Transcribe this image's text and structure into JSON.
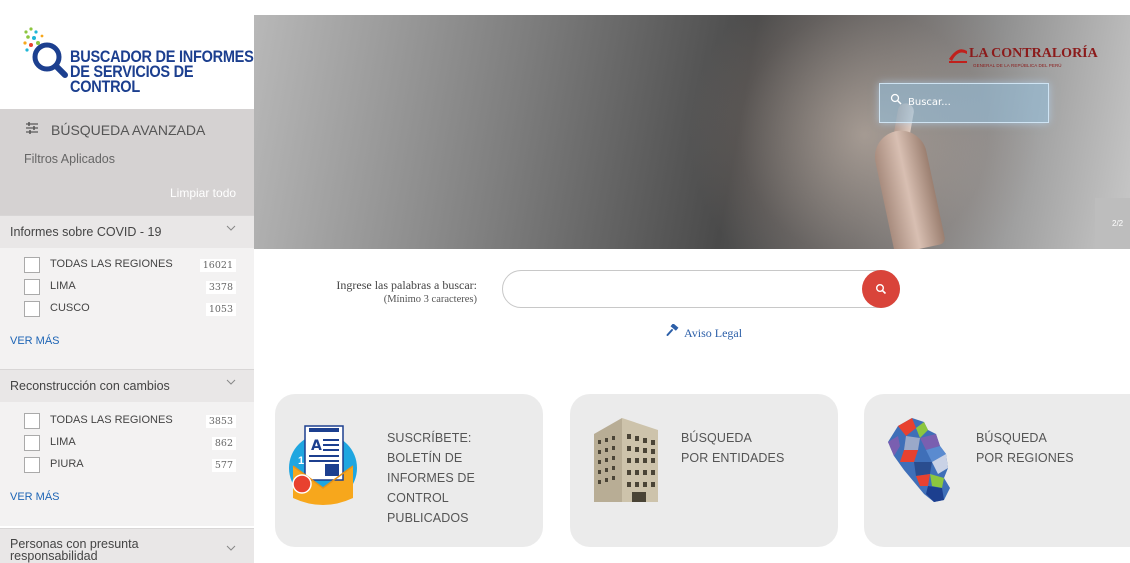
{
  "logo": {
    "line1": "BUSCADOR DE INFORMES",
    "line2": "DE SERVICIOS DE CONTROL"
  },
  "advanced": {
    "title": "BÚSQUEDA AVANZADA",
    "filters_label": "Filtros Aplicados",
    "clear_all": "Limpiar todo"
  },
  "sections": [
    {
      "title": "Informes sobre COVID - 19",
      "items": [
        {
          "label": "TODAS LAS REGIONES",
          "count": "16021"
        },
        {
          "label": "LIMA",
          "count": "3378"
        },
        {
          "label": "CUSCO",
          "count": "1053"
        }
      ],
      "see_more": "VER MÁS"
    },
    {
      "title": "Reconstrucción con cambios",
      "items": [
        {
          "label": "TODAS LAS REGIONES",
          "count": "3853"
        },
        {
          "label": "LIMA",
          "count": "862"
        },
        {
          "label": "PIURA",
          "count": "577"
        }
      ],
      "see_more": "VER MÁS"
    },
    {
      "title": "Personas con presunta responsabilidad"
    }
  ],
  "hero": {
    "brand_name": "LA CONTRALORÍA",
    "brand_sub": "GENERAL DE LA REPÚBLICA DEL PERÚ",
    "search_placeholder": "Buscar...",
    "slide_counter": "2/2"
  },
  "search": {
    "label": "Ingrese las palabras a buscar:",
    "hint": "(Mínimo 3 caracteres)",
    "value": "",
    "placeholder": ""
  },
  "legal": "Aviso Legal",
  "cards": [
    {
      "lines": [
        "SUSCRÍBETE:",
        "BOLETÍN DE",
        "INFORMES DE",
        "CONTROL",
        "PUBLICADOS"
      ],
      "icon": "newsletter-icon",
      "badge": "1"
    },
    {
      "lines": [
        "BÚSQUEDA",
        "POR ENTIDADES"
      ],
      "icon": "building-icon"
    },
    {
      "lines": [
        "BÚSQUEDA",
        "POR REGIONES"
      ],
      "icon": "peru-map-icon"
    }
  ],
  "colors": {
    "brand_blue": "#1c3f8f",
    "accent_red": "#d9443a",
    "link_blue": "#1c64b5",
    "sidebar_gray": "#d5d2d2",
    "card_gray": "#ebebeb"
  }
}
